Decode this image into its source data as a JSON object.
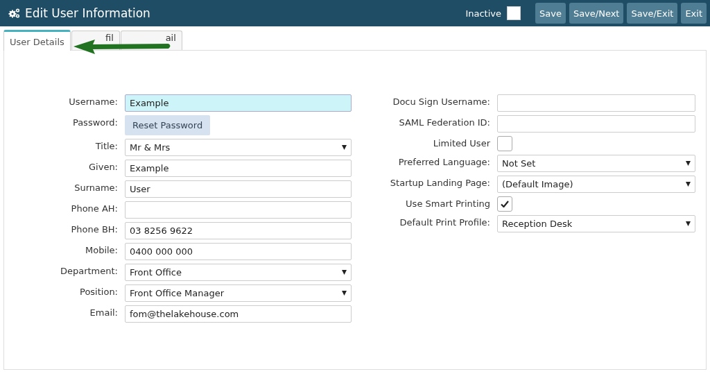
{
  "window": {
    "title": "Edit User Information"
  },
  "header": {
    "inactive": {
      "label": "Inactive",
      "checked": false
    },
    "buttons": [
      "Save",
      "Save/Next",
      "Save/Exit",
      "Exit"
    ]
  },
  "tabs": [
    {
      "label": "User Details",
      "selected": true
    },
    {
      "label": "fil",
      "selected": false
    },
    {
      "label": "ail",
      "selected": false
    }
  ],
  "left_fields": [
    {
      "kind": "text",
      "label": "Username:",
      "value": "Example",
      "focused": true
    },
    {
      "kind": "button",
      "label": "Password:",
      "value": "Reset Password"
    },
    {
      "kind": "select",
      "label": "Title:",
      "value": "Mr & Mrs"
    },
    {
      "kind": "text",
      "label": "Given:",
      "value": "Example",
      "focused": false
    },
    {
      "kind": "text",
      "label": "Surname:",
      "value": "User",
      "focused": false
    },
    {
      "kind": "text",
      "label": "Phone AH:",
      "focused": false
    },
    {
      "kind": "text",
      "label": "Phone BH:",
      "value": "03 8256 9622",
      "focused": false
    },
    {
      "kind": "text",
      "label": "Mobile:",
      "value": "0400 000 000",
      "focused": false
    },
    {
      "kind": "select",
      "label": "Department:",
      "value": "Front Office"
    },
    {
      "kind": "select",
      "label": "Position:",
      "value": "Front Office Manager"
    },
    {
      "kind": "text",
      "label": "Email:",
      "value": "fom@thelakehouse.com",
      "focused": false
    }
  ],
  "right_fields": [
    {
      "kind": "text",
      "label": "Docu Sign Username:",
      "focused": false
    },
    {
      "kind": "text",
      "label": "SAML Federation ID:",
      "focused": false
    },
    {
      "kind": "checkbox",
      "label": "Limited User",
      "checked": false
    },
    {
      "kind": "select",
      "label": "Preferred Language:",
      "value": "Not Set"
    },
    {
      "kind": "select",
      "label": "Startup Landing Page:",
      "value": "(Default Image)"
    },
    {
      "kind": "checkbox",
      "label": "Use Smart Printing",
      "checked": true
    },
    {
      "kind": "select",
      "label": "Default Print Profile:",
      "value": "Reception Desk"
    }
  ]
}
